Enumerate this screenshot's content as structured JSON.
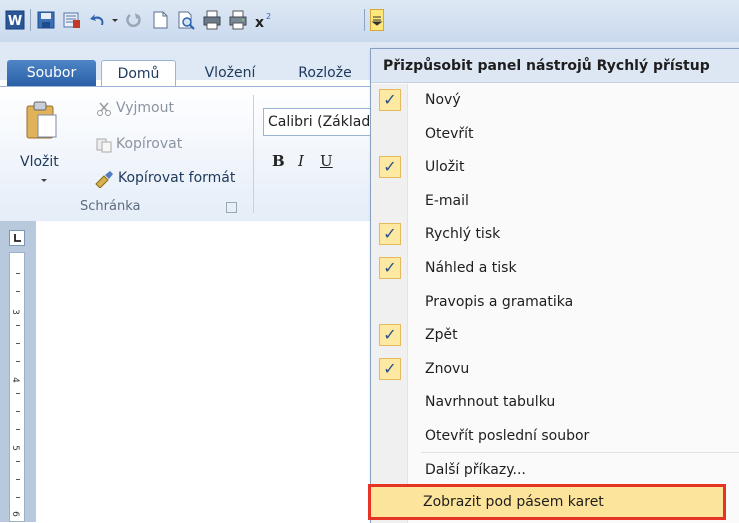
{
  "tabs": {
    "file": "Soubor",
    "home": "Domů",
    "insert": "Vložení",
    "layout": "Rozlože"
  },
  "clipboard": {
    "cut": "Vyjmout",
    "copy": "Kopírovat",
    "format_painter": "Kopírovat formát",
    "paste": "Vložit",
    "group": "Schránka"
  },
  "font": {
    "name": "Calibri (Základ",
    "bold": "B",
    "italic": "I",
    "underline": "U"
  },
  "ruler": {
    "n3": "3",
    "n4": "4",
    "n5": "5",
    "n6": "6"
  },
  "menu": {
    "title": "Přizpůsobit panel nástrojů Rychlý přístup",
    "items": [
      {
        "label": "Nový",
        "checked": true
      },
      {
        "label": "Otevřít",
        "checked": false
      },
      {
        "label": "Uložit",
        "checked": true
      },
      {
        "label": "E-mail",
        "checked": false
      },
      {
        "label": "Rychlý tisk",
        "checked": true
      },
      {
        "label": "Náhled a tisk",
        "checked": true
      },
      {
        "label": "Pravopis a gramatika",
        "checked": false
      },
      {
        "label": "Zpět",
        "checked": true
      },
      {
        "label": "Znovu",
        "checked": true
      },
      {
        "label": "Navrhnout tabulku",
        "checked": false
      },
      {
        "label": "Otevřít poslední soubor",
        "checked": false
      }
    ],
    "more_commands": "Další příkazy...",
    "show_below": "Zobrazit pod pásem karet"
  },
  "colors": {
    "accent": "#2a5fa6",
    "highlight_border": "#e53425",
    "check_bg": "#fde9a1"
  }
}
